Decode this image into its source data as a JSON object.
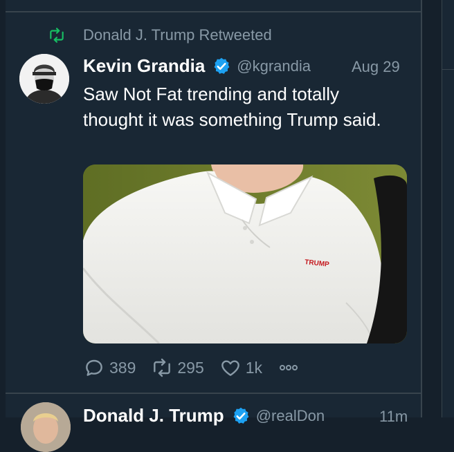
{
  "retweet": {
    "text": "Donald J. Trump Retweeted"
  },
  "tweet": {
    "author_name": "Kevin Grandia",
    "handle": "@kgrandia",
    "date": "Aug 29",
    "text": "Saw Not Fat trending and totally thought it was something Trump said.",
    "media": {
      "shirt_logo_text": "TRUMP"
    },
    "actions": {
      "replies": "389",
      "retweets": "295",
      "likes": "1k"
    }
  },
  "next_tweet": {
    "author_name": "Donald J. Trump",
    "handle": "@realDon",
    "time": "11m"
  },
  "colors": {
    "background": "#15202b",
    "column": "#192734",
    "retweet_green": "#17bf63",
    "verified_blue": "#1da1f2",
    "muted_text": "#8899a6",
    "border": "#38444d"
  },
  "icons": {
    "retweet": "retweet-icon",
    "verified": "verified-badge-icon",
    "reply": "reply-icon",
    "like": "heart-icon",
    "more": "more-options-icon"
  }
}
